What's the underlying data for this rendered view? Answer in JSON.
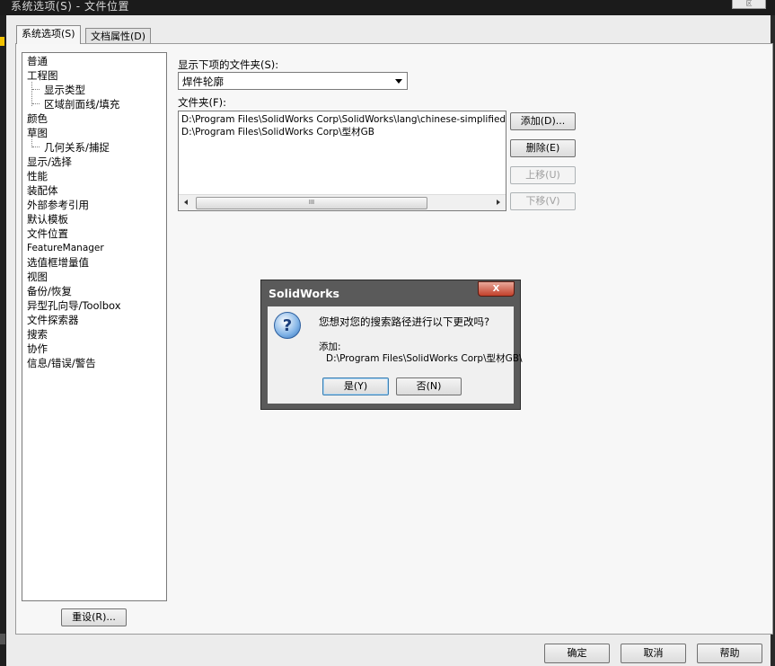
{
  "window": {
    "title": "系统选项(S) - 文件位置",
    "close_label": "区"
  },
  "tabs": [
    {
      "label": "系统选项(S)"
    },
    {
      "label": "文档属性(D)"
    }
  ],
  "tree": {
    "items": [
      {
        "label": "普通"
      },
      {
        "label": "工程图"
      },
      {
        "label": "显示类型"
      },
      {
        "label": "区域剖面线/填充"
      },
      {
        "label": "颜色"
      },
      {
        "label": "草图"
      },
      {
        "label": "几何关系/捕捉"
      },
      {
        "label": "显示/选择"
      },
      {
        "label": "性能"
      },
      {
        "label": "装配体"
      },
      {
        "label": "外部参考引用"
      },
      {
        "label": "默认模板"
      },
      {
        "label": "文件位置"
      },
      {
        "label": "FeatureManager"
      },
      {
        "label": "选值框增量值"
      },
      {
        "label": "视图"
      },
      {
        "label": "备份/恢复"
      },
      {
        "label": "异型孔向导/Toolbox"
      },
      {
        "label": "文件探索器"
      },
      {
        "label": "搜索"
      },
      {
        "label": "协作"
      },
      {
        "label": "信息/错误/警告"
      }
    ]
  },
  "reset_button": {
    "label": "重设(R)..."
  },
  "show_folders": {
    "label": "显示下项的文件夹(S):",
    "selected": "焊件轮廓"
  },
  "folders": {
    "label": "文件夹(F):",
    "rows": [
      "D:\\Program Files\\SolidWorks Corp\\SolidWorks\\lang\\chinese-simplified\\weldm",
      "D:\\Program Files\\SolidWorks Corp\\型材GB"
    ],
    "scroll_grip": "III"
  },
  "side_buttons": {
    "add": "添加(D)...",
    "delete": "删除(E)",
    "up": "上移(U)",
    "down": "下移(V)"
  },
  "dialog": {
    "title": "SolidWorks",
    "close_label": "X",
    "icon_glyph": "?",
    "question": "您想对您的搜索路径进行以下更改吗?",
    "add_label": "添加:",
    "path": "D:\\Program Files\\SolidWorks Corp\\型材GB\\",
    "yes": "是(Y)",
    "no": "否(N)"
  },
  "footer": {
    "ok": "确定",
    "cancel": "取消",
    "help": "帮助"
  }
}
